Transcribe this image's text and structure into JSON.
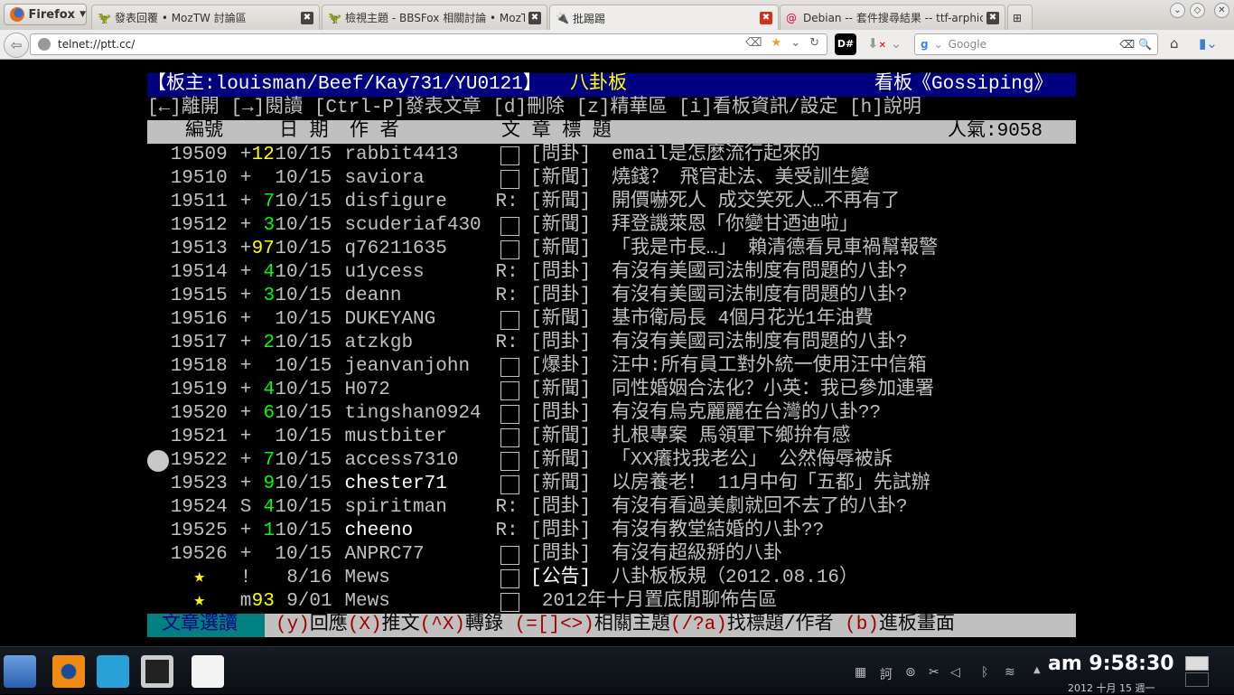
{
  "browser": {
    "menu_label": "Firefox",
    "tabs": [
      {
        "label": "發表回覆 • MozTW 討論區"
      },
      {
        "label": "檢視主題 - BBSFox 相關討論 • MozT···"
      },
      {
        "label": "批踢踢",
        "active": true
      },
      {
        "label": "Debian -- 套件搜尋結果 -- ttf-arphic-···"
      }
    ],
    "url": "telnet://ptt.cc/",
    "search_placeholder": "Google",
    "addon_label": "D#"
  },
  "bbs": {
    "header_left": "【板主:louisman/Beef/Kay731/YU0121】",
    "header_board": "八卦板",
    "header_right": "看板《Gossiping》",
    "menu": "[←]離開 [→]閱讀 [Ctrl-P]發表文章 [d]刪除 [z]精華區 [i]看板資訊/設定 [h]說明",
    "col_number": "編號",
    "col_date": "日 期",
    "col_author": "作  者",
    "col_title": "文  章  標  題",
    "popularity": "人氣:9058",
    "entries": [
      {
        "num": "19509",
        "mark": "+",
        "push": "12",
        "pc": "y",
        "date": "10/15",
        "author": "rabbit4413",
        "flag": "□",
        "cat": "[問卦]",
        "title": "email是怎麼流行起來的"
      },
      {
        "num": "19510",
        "mark": "+",
        "push": "",
        "pc": "",
        "date": "10/15",
        "author": "saviora",
        "flag": "□",
        "cat": "[新聞]",
        "title": "燒錢？ 飛官赴法、美受訓生變"
      },
      {
        "num": "19511",
        "mark": "+",
        "push": "7",
        "pc": "g",
        "date": "10/15",
        "author": "disfigure",
        "flag": "R:",
        "cat": "[新聞]",
        "title": "開價嚇死人 成交笑死人…不再有了"
      },
      {
        "num": "19512",
        "mark": "+",
        "push": "3",
        "pc": "g",
        "date": "10/15",
        "author": "scuderiaf430",
        "flag": "□",
        "cat": "[新聞]",
        "title": "拜登譏萊恩「你變甘迺迪啦」"
      },
      {
        "num": "19513",
        "mark": "+",
        "push": "97",
        "pc": "y",
        "date": "10/15",
        "author": "q76211635",
        "flag": "□",
        "cat": "[新聞]",
        "title": "「我是市長…」 賴清德看見車禍幫報警"
      },
      {
        "num": "19514",
        "mark": "+",
        "push": "4",
        "pc": "g",
        "date": "10/15",
        "author": "u1ycess",
        "flag": "R:",
        "cat": "[問卦]",
        "title": "有沒有美國司法制度有問題的八卦?"
      },
      {
        "num": "19515",
        "mark": "+",
        "push": "3",
        "pc": "g",
        "date": "10/15",
        "author": "deann",
        "flag": "R:",
        "cat": "[問卦]",
        "title": "有沒有美國司法制度有問題的八卦?"
      },
      {
        "num": "19516",
        "mark": "+",
        "push": "",
        "pc": "",
        "date": "10/15",
        "author": "DUKEYANG",
        "flag": "□",
        "cat": "[新聞]",
        "title": "基市衛局長 4個月花光1年油費"
      },
      {
        "num": "19517",
        "mark": "+",
        "push": "2",
        "pc": "g",
        "date": "10/15",
        "author": "atzkgb",
        "flag": "R:",
        "cat": "[問卦]",
        "title": "有沒有美國司法制度有問題的八卦?"
      },
      {
        "num": "19518",
        "mark": "+",
        "push": "",
        "pc": "",
        "date": "10/15",
        "author": "jeanvanjohn",
        "flag": "□",
        "cat": "[爆卦]",
        "title": "汪中:所有員工對外統一使用汪中信箱"
      },
      {
        "num": "19519",
        "mark": "+",
        "push": "4",
        "pc": "g",
        "date": "10/15",
        "author": "H072",
        "flag": "□",
        "cat": "[新聞]",
        "title": "同性婚姻合法化？小英：我已參加連署"
      },
      {
        "num": "19520",
        "mark": "+",
        "push": "6",
        "pc": "g",
        "date": "10/15",
        "author": "tingshan0924",
        "flag": "□",
        "cat": "[問卦]",
        "title": "有沒有烏克麗麗在台灣的八卦??"
      },
      {
        "num": "19521",
        "mark": "+",
        "push": "",
        "pc": "",
        "date": "10/15",
        "author": "mustbiter",
        "flag": "□",
        "cat": "[新聞]",
        "title": "扎根專案 馬領軍下鄉拚有感"
      },
      {
        "num": "19522",
        "mark": "+",
        "push": "7",
        "pc": "g",
        "date": "10/15",
        "author": "access7310",
        "flag": "□",
        "cat": "[新聞]",
        "title": "「XX癢找我老公」 公然侮辱被訴"
      },
      {
        "num": "19523",
        "mark": "+",
        "push": "9",
        "pc": "g",
        "date": "10/15",
        "author": "chester71",
        "bright": true,
        "flag": "□",
        "cat": "[新聞]",
        "title": "以房養老！  11月中旬「五都」先試辦"
      },
      {
        "num": "19524",
        "mark": "S",
        "push": "4",
        "pc": "g",
        "date": "10/15",
        "author": "spiritman",
        "flag": "R:",
        "cat": "[問卦]",
        "title": "有沒有看過美劇就回不去了的八卦?"
      },
      {
        "num": "19525",
        "mark": "+",
        "push": "1",
        "pc": "g",
        "date": "10/15",
        "author": "cheeno",
        "bright": true,
        "flag": "R:",
        "cat": "[問卦]",
        "title": "有沒有教堂結婚的八卦??"
      },
      {
        "num": "19526",
        "mark": "+",
        "push": "",
        "pc": "",
        "date": "10/15",
        "author": "ANPRC77",
        "flag": "□",
        "cat": "[問卦]",
        "title": "有沒有超級掰的八卦"
      },
      {
        "num": "★",
        "star": true,
        "mark": "!",
        "push": "",
        "pc": "",
        "date": "8/16",
        "author": "Mews",
        "flag": "□",
        "cat": "[公告]",
        "catbright": true,
        "title": "八卦板板規（2012.08.16）"
      },
      {
        "num": "★",
        "star": true,
        "mark": "m",
        "push": "93",
        "pc": "y",
        "date": "9/01",
        "author": "Mews",
        "flag": "□",
        "cat": "",
        "title": "2012年十月置底閒聊佈告區"
      }
    ],
    "footer_mode": "文章選讀",
    "footer_items": [
      {
        "key": "(y)",
        "label": "回應"
      },
      {
        "key": "(X)",
        "label": "推文"
      },
      {
        "key": "(^X)",
        "label": "轉錄 "
      },
      {
        "key": "(=[]<>)",
        "label": "相關主題"
      },
      {
        "key": "(/?a)",
        "label": "找標題/作者 "
      },
      {
        "key": "(b)",
        "label": "進板畫面"
      }
    ]
  },
  "taskbar": {
    "clock": "am 9:58:30",
    "date": "2012 十月 15 週一",
    "ime": "訶"
  },
  "colors": {
    "push_high": "#ffff00",
    "push_low": "#00ff00",
    "header_bg": "#000080",
    "footer_mode_bg": "#008080"
  }
}
